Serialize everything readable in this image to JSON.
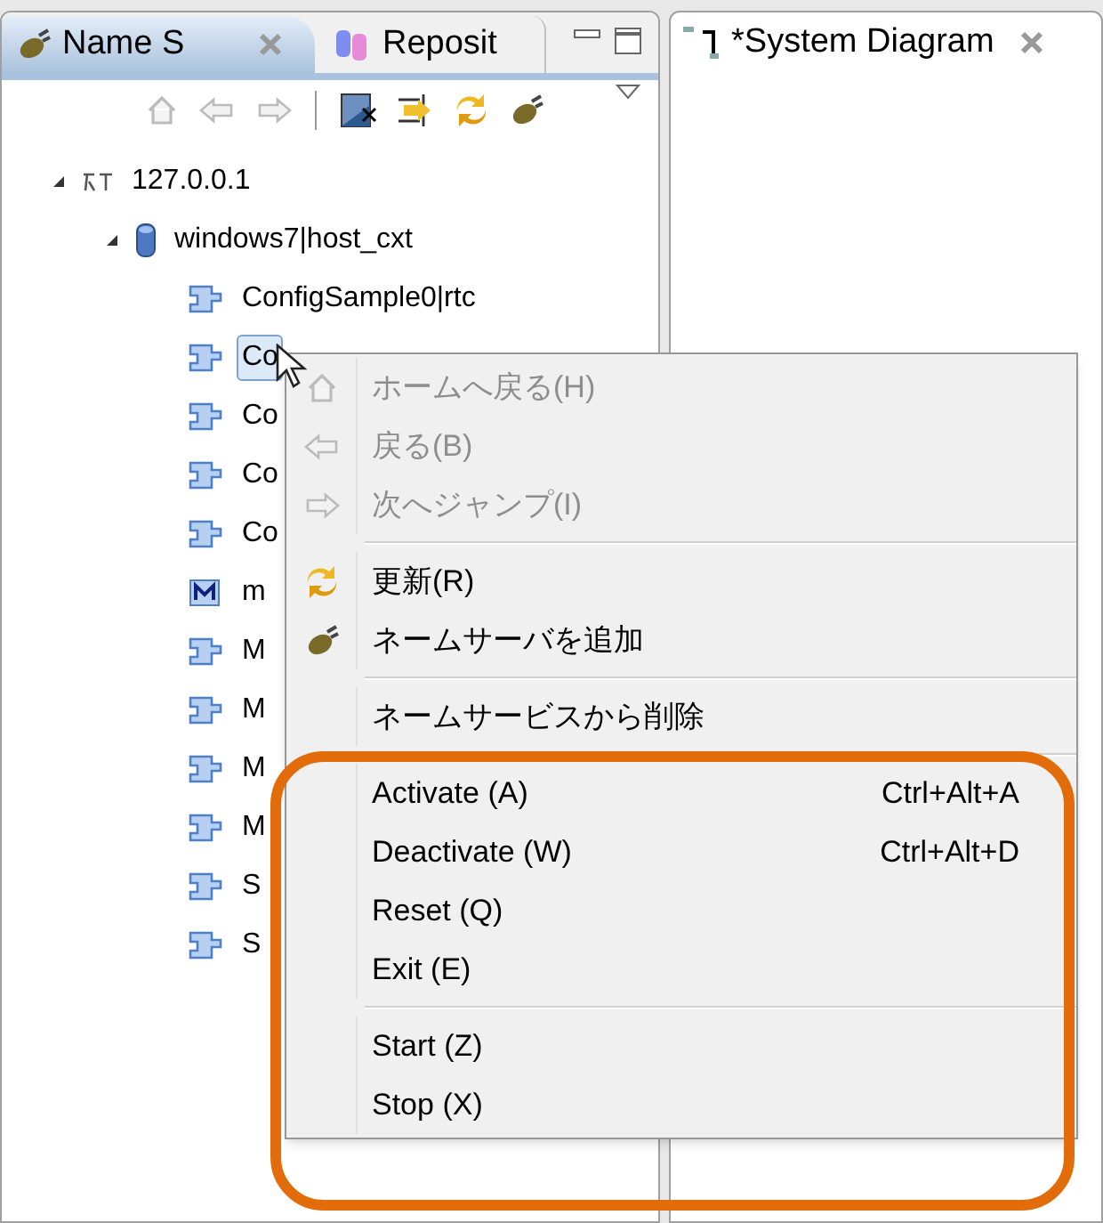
{
  "left_panel": {
    "tabs": [
      {
        "label": "Name S",
        "selected": true,
        "kind": "plug"
      },
      {
        "label": "Reposit",
        "selected": false,
        "kind": "cylinders"
      }
    ],
    "tree": [
      {
        "label": "127.0.0.1",
        "kind": "rt",
        "expanded": true,
        "selected": false,
        "children": [
          {
            "label": "windows7|host_cxt",
            "kind": "host",
            "expanded": true,
            "selected": false,
            "children": [
              {
                "label": "ConfigSample0|rtc",
                "kind": "component",
                "selected": false
              },
              {
                "label": "Co",
                "kind": "component",
                "selected": true
              },
              {
                "label": "Co",
                "kind": "component",
                "selected": false
              },
              {
                "label": "Co",
                "kind": "component",
                "selected": false
              },
              {
                "label": "Co",
                "kind": "component",
                "selected": false
              },
              {
                "label": "m",
                "kind": "manager",
                "selected": false
              },
              {
                "label": "M",
                "kind": "component",
                "selected": false
              },
              {
                "label": "M",
                "kind": "component",
                "selected": false
              },
              {
                "label": "M",
                "kind": "component",
                "selected": false
              },
              {
                "label": "M",
                "kind": "component",
                "selected": false
              },
              {
                "label": "S",
                "kind": "component",
                "selected": false
              },
              {
                "label": "S",
                "kind": "component",
                "selected": false
              }
            ]
          }
        ]
      }
    ]
  },
  "right_panel": {
    "tab": {
      "label": "*System Diagram"
    }
  },
  "context_menu": {
    "items": [
      {
        "kind": "home",
        "label": "ホームへ戻る(H)",
        "disabled": true
      },
      {
        "kind": "back",
        "label": "戻る(B)",
        "disabled": true
      },
      {
        "kind": "forward",
        "label": "次へジャンプ(I)",
        "disabled": true
      },
      {
        "kind": "separator"
      },
      {
        "kind": "refresh",
        "label": "更新(R)",
        "disabled": false
      },
      {
        "kind": "plug",
        "label": "ネームサーバを追加",
        "disabled": false
      },
      {
        "kind": "separator"
      },
      {
        "kind": "plain",
        "label": "ネームサービスから削除",
        "disabled": false
      },
      {
        "kind": "separator"
      },
      {
        "kind": "plain",
        "label": "Activate (A)",
        "shortcut": "Ctrl+Alt+A",
        "disabled": false
      },
      {
        "kind": "plain",
        "label": "Deactivate (W)",
        "shortcut": "Ctrl+Alt+D",
        "disabled": false
      },
      {
        "kind": "plain",
        "label": "Reset (Q)",
        "disabled": false
      },
      {
        "kind": "plain",
        "label": "Exit (E)",
        "disabled": false
      },
      {
        "kind": "separator"
      },
      {
        "kind": "plain",
        "label": "Start (Z)",
        "disabled": false
      },
      {
        "kind": "plain",
        "label": "Stop (X)",
        "disabled": false
      }
    ]
  }
}
